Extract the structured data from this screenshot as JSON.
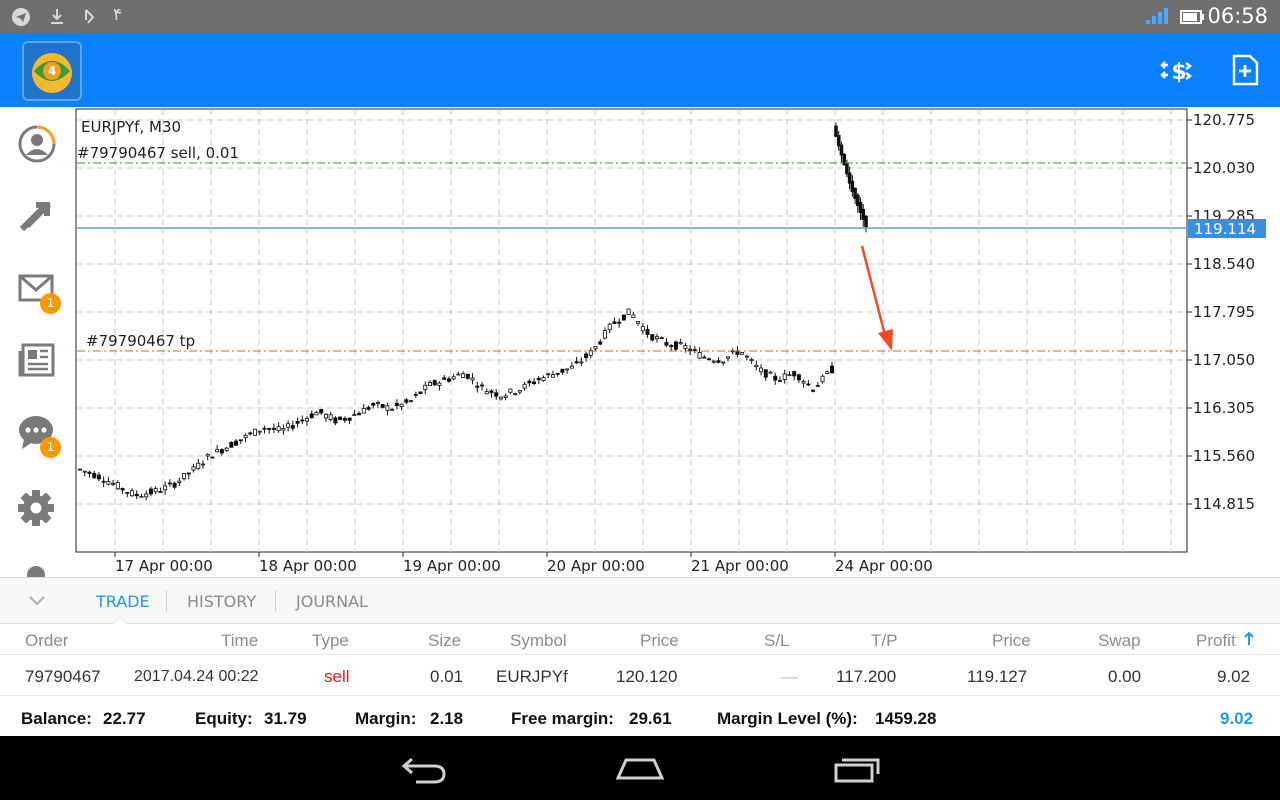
{
  "status_bar": {
    "clock": "06:58",
    "notification_count": "۴"
  },
  "chart": {
    "symbol_timeframe": "EURJPYf, M30",
    "order_label": "#79790467 sell, 0.01",
    "tp_label": "#79790467 tp",
    "current_price": "119.114",
    "price_axis": [
      "120.775",
      "120.030",
      "119.285",
      "118.540",
      "117.795",
      "117.050",
      "116.305",
      "115.560",
      "114.815"
    ],
    "time_axis": [
      "17 Apr 00:00",
      "18 Apr 00:00",
      "19 Apr 00:00",
      "20 Apr 00:00",
      "21 Apr 00:00",
      "24 Apr 00:00"
    ],
    "colors": {
      "bid_line": "#3b8de0",
      "order_line": "#2e9b2e",
      "tp_line": "#d2691e",
      "arrow": "#f04a2a",
      "grid": "#c8c8c8"
    }
  },
  "chart_data": {
    "type": "candlestick",
    "symbol": "EURJPYf",
    "timeframe": "M30",
    "x_ticks": [
      "17 Apr 00:00",
      "18 Apr 00:00",
      "19 Apr 00:00",
      "20 Apr 00:00",
      "21 Apr 00:00",
      "24 Apr 00:00"
    ],
    "y_ticks": [
      120.775,
      120.03,
      119.285,
      118.54,
      117.795,
      117.05,
      116.305,
      115.56,
      114.815
    ],
    "ylim": [
      114.2,
      120.95
    ],
    "grid": true,
    "levels": [
      {
        "name": "#79790467 sell, 0.01",
        "value": 120.12
      },
      {
        "name": "bid",
        "value": 119.114
      },
      {
        "name": "#79790467 tp",
        "value": 117.2
      }
    ],
    "approx_close_series": [
      115.35,
      115.25,
      115.1,
      114.95,
      115.0,
      115.1,
      115.3,
      115.55,
      115.7,
      115.85,
      116.0,
      115.95,
      116.1,
      116.25,
      116.1,
      116.2,
      116.35,
      116.3,
      116.4,
      116.65,
      116.75,
      116.85,
      116.6,
      116.5,
      116.6,
      116.75,
      116.85,
      116.95,
      117.2,
      117.6,
      117.8,
      117.45,
      117.3,
      117.25,
      117.1,
      117.05,
      117.2,
      116.9,
      116.75,
      116.85,
      116.6,
      116.9,
      120.6,
      120.2,
      119.8,
      119.5,
      119.2
    ]
  },
  "tabs": [
    {
      "label": "TRADE",
      "active": true
    },
    {
      "label": "HISTORY",
      "active": false
    },
    {
      "label": "JOURNAL",
      "active": false
    }
  ],
  "table": {
    "headers": [
      "Order",
      "Time",
      "Type",
      "Size",
      "Symbol",
      "Price",
      "S/L",
      "T/P",
      "Price",
      "Swap",
      "Profit"
    ],
    "rows": [
      {
        "order": "79790467",
        "time": "2017.04.24 00:22",
        "type": "sell",
        "size": "0.01",
        "symbol": "EURJPYf",
        "price": "120.120",
        "sl": "—",
        "tp": "117.200",
        "current_price": "119.127",
        "swap": "0.00",
        "profit": "9.02"
      }
    ]
  },
  "summary": {
    "balance_label": "Balance:",
    "balance": "22.77",
    "equity_label": "Equity:",
    "equity": "31.79",
    "margin_label": "Margin:",
    "margin": "2.18",
    "free_margin_label": "Free margin:",
    "free_margin": "29.61",
    "margin_level_label": "Margin Level (%):",
    "margin_level": "1459.28",
    "total_profit": "9.02"
  },
  "sidebar": {
    "items": [
      {
        "name": "account",
        "badge": ""
      },
      {
        "name": "trade",
        "badge": ""
      },
      {
        "name": "mailbox",
        "badge": "1"
      },
      {
        "name": "news",
        "badge": ""
      },
      {
        "name": "chat",
        "badge": "1"
      },
      {
        "name": "settings",
        "badge": ""
      }
    ]
  }
}
